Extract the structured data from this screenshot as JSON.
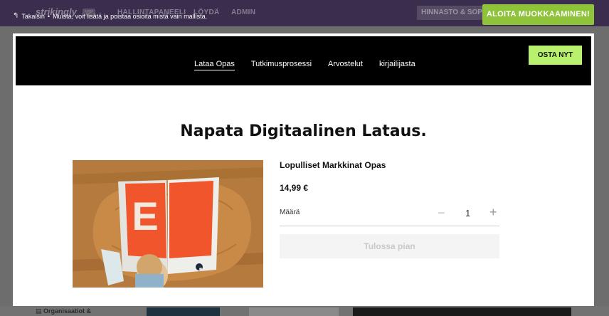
{
  "editor": {
    "brand": "strikingly",
    "brand_badge": "VIP",
    "nav": [
      "HALLINTAPANEELI",
      "LÖYDÄ",
      "ADMIN"
    ],
    "pricing": "HINNASTO & SOPIMUKSET",
    "back_label": "Takaisin",
    "separator": "•",
    "hint": "Muista, voit lisätä ja poistaa osioita mistä vain mallista.",
    "start_button": "ALOITA MUOKKAAMINEN!",
    "sidebar_label": "Organisaatiot &"
  },
  "site": {
    "nav": [
      "Lataa Opas",
      "Tutkimusprosessi",
      "Arvostelut",
      "kirjailijasta"
    ],
    "buy_button": "OSTA NYT",
    "heading": "Napata Digitaalinen Lataus.",
    "product": {
      "title": "Lopulliset Markkinat Opas",
      "price": "14,99 €",
      "quantity_label": "Määrä",
      "quantity": "1",
      "minus": "−",
      "plus": "+",
      "cta": "Tulossa pian",
      "book_letter": "E"
    }
  },
  "colors": {
    "accent_green": "#8fc43a",
    "buy_green": "#b9f06e",
    "book_orange": "#f0552b"
  }
}
